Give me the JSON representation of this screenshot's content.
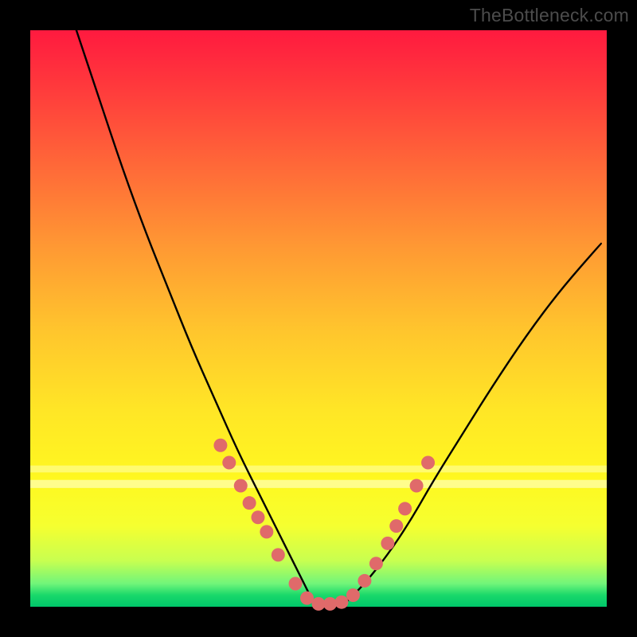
{
  "attribution": "TheBottleneck.com",
  "colors": {
    "frame": "#000000",
    "curve_stroke": "#000000",
    "dot_fill": "#e06a6a",
    "dot_stroke": "#d85f5f"
  },
  "chart_data": {
    "type": "line",
    "title": "",
    "xlabel": "",
    "ylabel": "",
    "xlim": [
      0,
      100
    ],
    "ylim": [
      0,
      100
    ],
    "grid": false,
    "legend": false,
    "note": "Bottleneck-style V-curve. x ≈ relative component score, y ≈ bottleneck %. Minimum between ~45–55 at ~0%. Background gradient runs red (100%) → green (0%).",
    "series": [
      {
        "name": "left-branch",
        "x": [
          8,
          12,
          16,
          20,
          24,
          28,
          32,
          36,
          40,
          44,
          47,
          49
        ],
        "y": [
          100,
          88,
          76,
          65,
          55,
          45,
          36,
          27,
          19,
          11,
          5,
          1
        ]
      },
      {
        "name": "floor",
        "x": [
          49,
          51,
          53,
          55
        ],
        "y": [
          1,
          0,
          0,
          1
        ]
      },
      {
        "name": "right-branch",
        "x": [
          55,
          58,
          62,
          66,
          70,
          75,
          80,
          86,
          92,
          99
        ],
        "y": [
          1,
          4,
          9,
          15,
          22,
          30,
          38,
          47,
          55,
          63
        ]
      }
    ],
    "markers": {
      "name": "sample-dots",
      "note": "pink circular markers near the trough on both branches",
      "x": [
        33,
        34.5,
        36.5,
        38,
        39.5,
        41,
        43,
        46,
        48,
        50,
        52,
        54,
        56,
        58,
        60,
        62,
        63.5,
        65,
        67,
        69
      ],
      "y": [
        28,
        25,
        21,
        18,
        15.5,
        13,
        9,
        4,
        1.5,
        0.5,
        0.5,
        0.8,
        2,
        4.5,
        7.5,
        11,
        14,
        17,
        21,
        25
      ]
    },
    "background_bands_pct_from_top": [
      {
        "at": 75.5,
        "h": 1.2,
        "color": "#ffffb0",
        "alpha": 0.55
      },
      {
        "at": 78.0,
        "h": 1.4,
        "color": "#ffffc8",
        "alpha": 0.65
      }
    ]
  }
}
